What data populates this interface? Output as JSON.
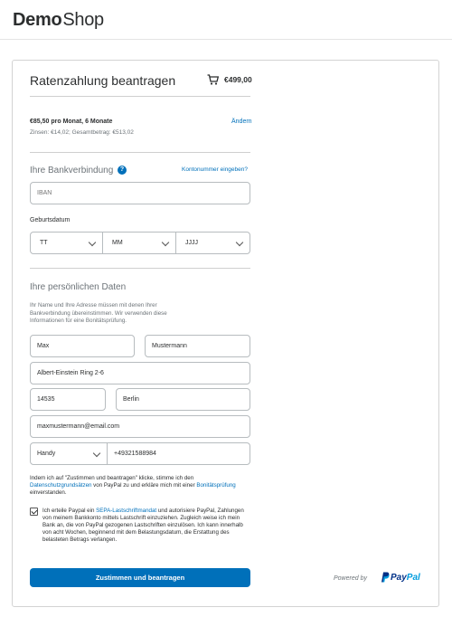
{
  "header": {
    "logo_bold": "Demo",
    "logo_light": "Shop"
  },
  "summary": {
    "title": "Ratenzahlung beantragen",
    "cart_icon": "cart-icon",
    "amount": "€499,00",
    "plan": "€85,50 pro Monat, 6 Monate",
    "interest": "Zinsen: €14,02; Gesamtbetrag: €513,02",
    "change_link": "Ändern"
  },
  "bank": {
    "heading": "Ihre Bankverbindung",
    "help_icon": "question-icon",
    "konto_link": "Kontonummer eingeben?",
    "iban_placeholder": "IBAN"
  },
  "birthdate": {
    "label": "Geburtsdatum",
    "day": "TT",
    "month": "MM",
    "year": "JJJJ"
  },
  "personal": {
    "heading": "Ihre persönlichen Daten",
    "info": "Ihr Name und Ihre Adresse müssen mit denen Ihrer Bankverbindung übereinstimmen. Wir verwenden diese Informationen für eine Bonitätsprüfung.",
    "first_name": "Max",
    "last_name": "Mustermann",
    "street": "Albert-Einstein Ring 2-6",
    "zip": "14535",
    "city": "Berlin",
    "email": "maxmustermann@email.com",
    "phone_type": "Handy",
    "phone": "+49321588984"
  },
  "consent": {
    "text_1": "Indem ich auf \"Zustimmen und beantragen\" klicke, stimme ich den ",
    "privacy_link": "Datenschutzgrundsätzen",
    "text_2": " von PayPal zu und erkläre mich mit einer ",
    "credit_check_link": "Bonitätsprüfung",
    "text_3": " einverstanden."
  },
  "mandate": {
    "checked": true,
    "text_1": "Ich erteile Paypal ein ",
    "sepa_link": "SEPA-Lastschriftmandat",
    "text_2": " und autorisiere PayPal, Zahlungen von meinem Bankkonto mittels Lastschrift einzuziehen. Zugleich weise ich mein Bank an, die von PayPal gezogenen Lastschriften einzulösen. Ich kann innerhalb von acht Wochen, beginnend mit dem Belastungsdatum, die Erstattung des belasteten Betrags verlangen."
  },
  "footer": {
    "submit_label": "Zustimmen und beantragen",
    "powered_by": "Powered by",
    "brand_pay": "Pay",
    "brand_pal": "Pal",
    "brand_icon": "paypal-icon"
  },
  "colors": {
    "accent": "#0070ba",
    "paypal_dark": "#003087",
    "paypal_light": "#009cde"
  }
}
